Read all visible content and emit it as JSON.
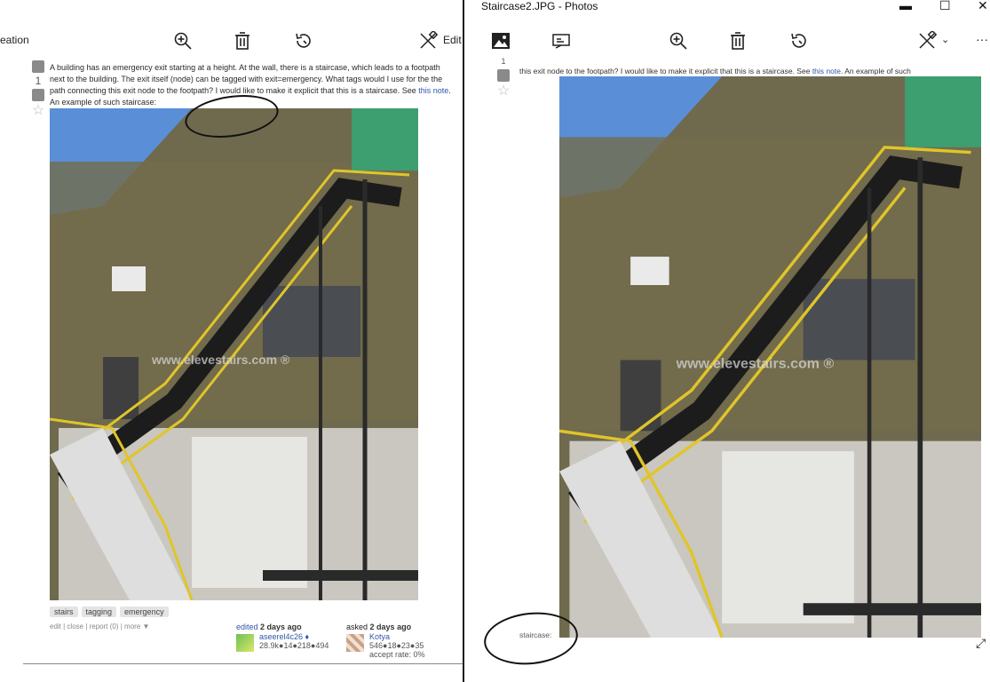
{
  "left_window": {
    "toolbar": {
      "partial_label": "eation",
      "edit_label": "Edit",
      "icons": [
        "zoom-in-icon",
        "delete-icon",
        "rotate-icon",
        "edit-create-icon"
      ]
    },
    "post": {
      "vote_count": "1",
      "question_text": "A building has an emergency exit starting at a height. At the wall, there is a staircase, which leads to a footpath next to the building. The exit itself (node) can be tagged with exit=emergency. What tags would I use for the the path connecting this exit node to the footpath? I would like to make it explicit that this is a staircase. See",
      "link_text": "this note",
      "tail_text": ". An example of such staircase:",
      "watermark": "www.elevestairs.com ®",
      "tags": [
        "stairs",
        "tagging",
        "emergency"
      ],
      "menu": "edit | close | report (0) | more ▼",
      "edited": {
        "action": "edited",
        "when": "2 days ago",
        "user": "aseerel4c26 ♦",
        "rep": "28.9k●14●218●494"
      },
      "asked": {
        "action": "asked",
        "when": "2 days ago",
        "user": "Kotya",
        "rep": "546●18●23●35",
        "accept": "accept rate: 0%"
      }
    }
  },
  "right_window": {
    "title": "Staircase2.JPG - Photos",
    "controls": {
      "minimize": "▬",
      "maximize": "☐",
      "close": "✕"
    },
    "toolbar": {
      "more": "···"
    },
    "post_fragment": {
      "vote_count": "1",
      "text": "this exit node to the footpath? I would like to make it explicit that this is a staircase. See",
      "link_text": "this note",
      "tail_text": ". An example of such",
      "caption": "staircase:",
      "watermark": "www.elevestairs.com ®"
    }
  },
  "colors": {
    "stair_yellow": "#e0c52a",
    "wall": "#6f6a4e",
    "sky": "#5a8fd8",
    "link": "#3355aa"
  }
}
